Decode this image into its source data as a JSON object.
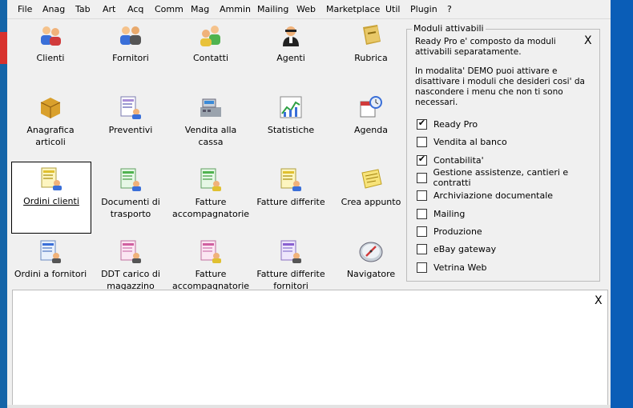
{
  "menu": [
    "File",
    "Anag",
    "Tab",
    "Art",
    "Acq",
    "Comm",
    "Mag",
    "Ammin",
    "Mailing",
    "Web",
    "Marketplace",
    "Util",
    "Plugin",
    "?"
  ],
  "tiles": [
    {
      "label": "Clienti",
      "icon": "clients-icon"
    },
    {
      "label": "Fornitori",
      "icon": "suppliers-icon"
    },
    {
      "label": "Contatti",
      "icon": "contacts-icon"
    },
    {
      "label": "Agenti",
      "icon": "agent-icon"
    },
    {
      "label": "Rubrica",
      "icon": "address-book-icon"
    },
    {
      "label": "Anagrafica articoli",
      "icon": "boxes-icon"
    },
    {
      "label": "Preventivi",
      "icon": "quote-doc-icon"
    },
    {
      "label": "Vendita alla cassa",
      "icon": "cash-register-icon"
    },
    {
      "label": "Statistiche",
      "icon": "chart-icon"
    },
    {
      "label": "Agenda",
      "icon": "calendar-clock-icon"
    },
    {
      "label": "Ordini clienti",
      "icon": "order-doc-icon",
      "selected": true
    },
    {
      "label": "Documenti di trasporto",
      "icon": "transport-doc-icon"
    },
    {
      "label": "Fatture accompagnatorie",
      "icon": "invoice-doc-icon"
    },
    {
      "label": "Fatture differite",
      "icon": "deferred-invoice-icon"
    },
    {
      "label": "Crea appunto",
      "icon": "note-icon"
    },
    {
      "label": "Ordini a fornitori",
      "icon": "supplier-order-icon"
    },
    {
      "label": "DDT carico di magazzino",
      "icon": "warehouse-doc-icon"
    },
    {
      "label": "Fatture accompagnatorie",
      "icon": "invoice-doc-icon"
    },
    {
      "label": "Fatture differite fornitori",
      "icon": "supplier-invoice-icon"
    },
    {
      "label": "Navigatore",
      "icon": "compass-icon"
    }
  ],
  "modules": {
    "title": "Moduli attivabili",
    "close": "X",
    "info1": "Ready Pro e' composto da moduli attivabili separatamente.",
    "info2": "In modalita' DEMO puoi attivare e disattivare i moduli che desideri cosi' da nascondere i menu che non ti sono necessari.",
    "items": [
      {
        "label": "Ready Pro",
        "checked": true
      },
      {
        "label": "Vendita al banco",
        "checked": false
      },
      {
        "label": "Contabilita'",
        "checked": true
      },
      {
        "label": "Gestione assistenze, cantieri e contratti",
        "checked": false
      },
      {
        "label": "Archiviazione documentale",
        "checked": false
      },
      {
        "label": "Mailing",
        "checked": false
      },
      {
        "label": "Produzione",
        "checked": false
      },
      {
        "label": "eBay gateway",
        "checked": false
      },
      {
        "label": "Vetrina Web",
        "checked": false
      }
    ]
  },
  "bottom": {
    "close": "X"
  }
}
